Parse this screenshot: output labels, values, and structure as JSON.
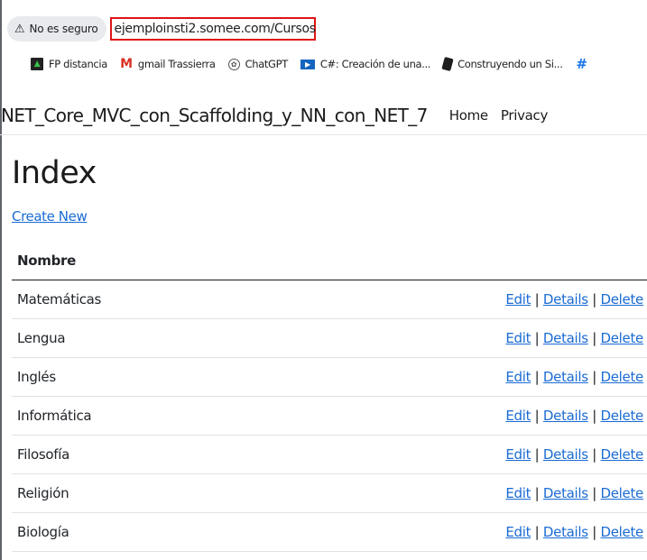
{
  "browser": {
    "security_label": "No es seguro",
    "url": "ejemploinsti2.somee.com/Cursos",
    "bookmarks": [
      {
        "label": "FP distancia",
        "icon": "fp-distancia-icon"
      },
      {
        "label": "gmail Trassierra",
        "icon": "gmail-icon"
      },
      {
        "label": "ChatGPT",
        "icon": "chatgpt-icon"
      },
      {
        "label": "C#: Creación de una...",
        "icon": "video-icon"
      },
      {
        "label": "Construyendo un Si...",
        "icon": "bookmark-app-icon"
      }
    ],
    "accent": "#e01414"
  },
  "nav": {
    "brand": "NET_Core_MVC_con_Scaffolding_y_NN_con_NET_7",
    "links": [
      "Home",
      "Privacy"
    ]
  },
  "main": {
    "title": "Index",
    "create_new": "Create New",
    "column_header": "Nombre",
    "rows": [
      "Matemáticas",
      "Lengua",
      "Inglés",
      "Informática",
      "Filosofía",
      "Religión",
      "Biología"
    ],
    "actions": {
      "edit": "Edit",
      "details": "Details",
      "delete": "Delete",
      "separator": "|"
    }
  }
}
